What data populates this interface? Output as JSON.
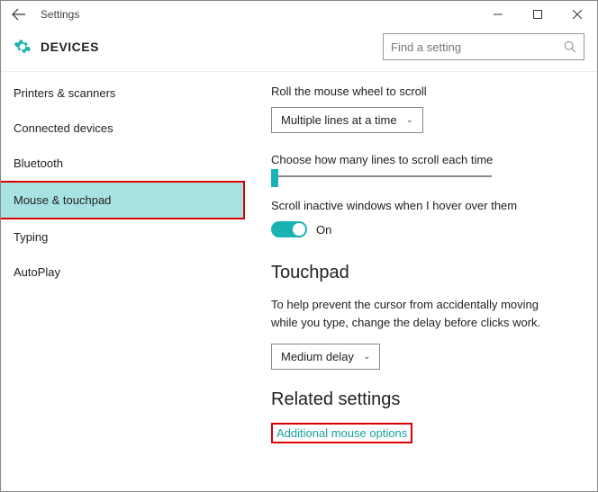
{
  "window": {
    "title": "Settings"
  },
  "header": {
    "label": "DEVICES",
    "search_placeholder": "Find a setting"
  },
  "sidebar": {
    "items": [
      {
        "label": "Printers & scanners"
      },
      {
        "label": "Connected devices"
      },
      {
        "label": "Bluetooth"
      },
      {
        "label": "Mouse & touchpad"
      },
      {
        "label": "Typing"
      },
      {
        "label": "AutoPlay"
      }
    ],
    "selected_index": 3
  },
  "content": {
    "scroll_label": "Roll the mouse wheel to scroll",
    "scroll_value": "Multiple lines at a time",
    "lines_label": "Choose how many lines to scroll each time",
    "inactive_label": "Scroll inactive windows when I hover over them",
    "inactive_state": "On",
    "touchpad_heading": "Touchpad",
    "touchpad_para": "To help prevent the cursor from accidentally moving while you type, change the delay before clicks work.",
    "touchpad_delay_value": "Medium delay",
    "related_heading": "Related settings",
    "related_link": "Additional mouse options"
  }
}
